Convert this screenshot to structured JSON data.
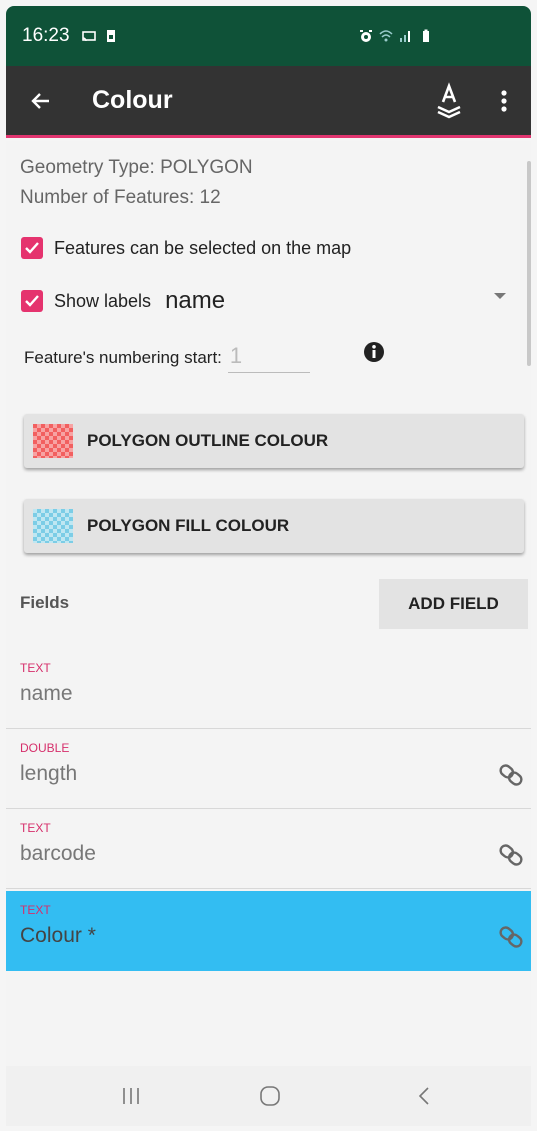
{
  "status_bar": {
    "time": "16:23"
  },
  "app_bar": {
    "title": "Colour"
  },
  "layer_info": {
    "geometry_type": "Geometry Type: POLYGON",
    "feature_count": "Number of Features: 12"
  },
  "options": {
    "selectable_label": "Features can be selected on the map",
    "show_labels_label": "Show labels",
    "label_field_value": "name",
    "numbering_label": "Feature's numbering start:",
    "numbering_value": "1"
  },
  "buttons": {
    "outline_colour": "POLYGON OUTLINE COLOUR",
    "fill_colour": "POLYGON FILL COLOUR",
    "add_field": "ADD FIELD"
  },
  "fields": {
    "heading": "Fields",
    "items": [
      {
        "type": "TEXT",
        "name": "name"
      },
      {
        "type": "DOUBLE",
        "name": "length"
      },
      {
        "type": "TEXT",
        "name": "barcode"
      },
      {
        "type": "TEXT",
        "name": "Colour *"
      }
    ]
  },
  "colors": {
    "status_bar": "#0f5238",
    "app_bar": "#333333",
    "accent": "#e5336e",
    "selected_row": "#33bdf2"
  }
}
